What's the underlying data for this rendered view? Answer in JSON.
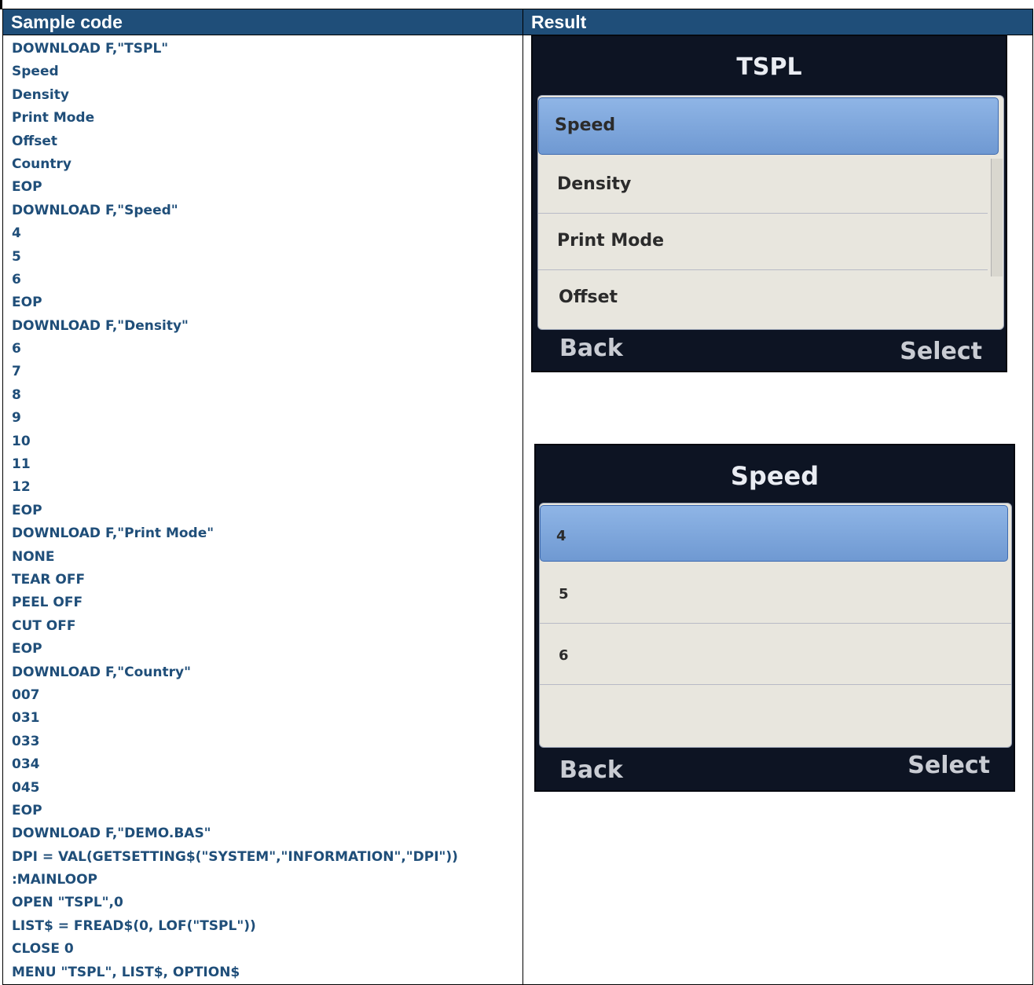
{
  "headers": {
    "col1": "Sample code",
    "col2": "Result"
  },
  "code_lines": [
    "DOWNLOAD F,\"TSPL\"",
    "Speed",
    "Density",
    "Print Mode",
    "Offset",
    "Country",
    "EOP",
    "DOWNLOAD F,\"Speed\"",
    "4",
    "5",
    "6",
    "EOP",
    "DOWNLOAD F,\"Density\"",
    "6",
    "7",
    "8",
    "9",
    "10",
    "11",
    "12",
    "EOP",
    "DOWNLOAD F,\"Print Mode\"",
    "NONE",
    "TEAR OFF",
    "PEEL OFF",
    "CUT OFF",
    "EOP",
    "DOWNLOAD F,\"Country\"",
    "007",
    "031",
    "033",
    "034",
    "045",
    "EOP",
    "DOWNLOAD F,\"DEMO.BAS\"",
    "DPI = VAL(GETSETTING$(\"SYSTEM\",\"INFORMATION\",\"DPI\"))",
    ":MAINLOOP",
    "OPEN \"TSPL\",0",
    "LIST$ = FREAD$(0, LOF(\"TSPL\"))",
    "CLOSE 0",
    "MENU \"TSPL\", LIST$, OPTION$"
  ],
  "screen_tspl": {
    "title": "TSPL",
    "items": [
      "Speed",
      "Density",
      "Print Mode",
      "Offset"
    ],
    "selected_index": 0,
    "back_label": "Back",
    "select_label": "Select"
  },
  "screen_speed": {
    "title": "Speed",
    "items": [
      "4",
      "5",
      "6",
      ""
    ],
    "selected_index": 0,
    "back_label": "Back",
    "select_label": "Select"
  }
}
